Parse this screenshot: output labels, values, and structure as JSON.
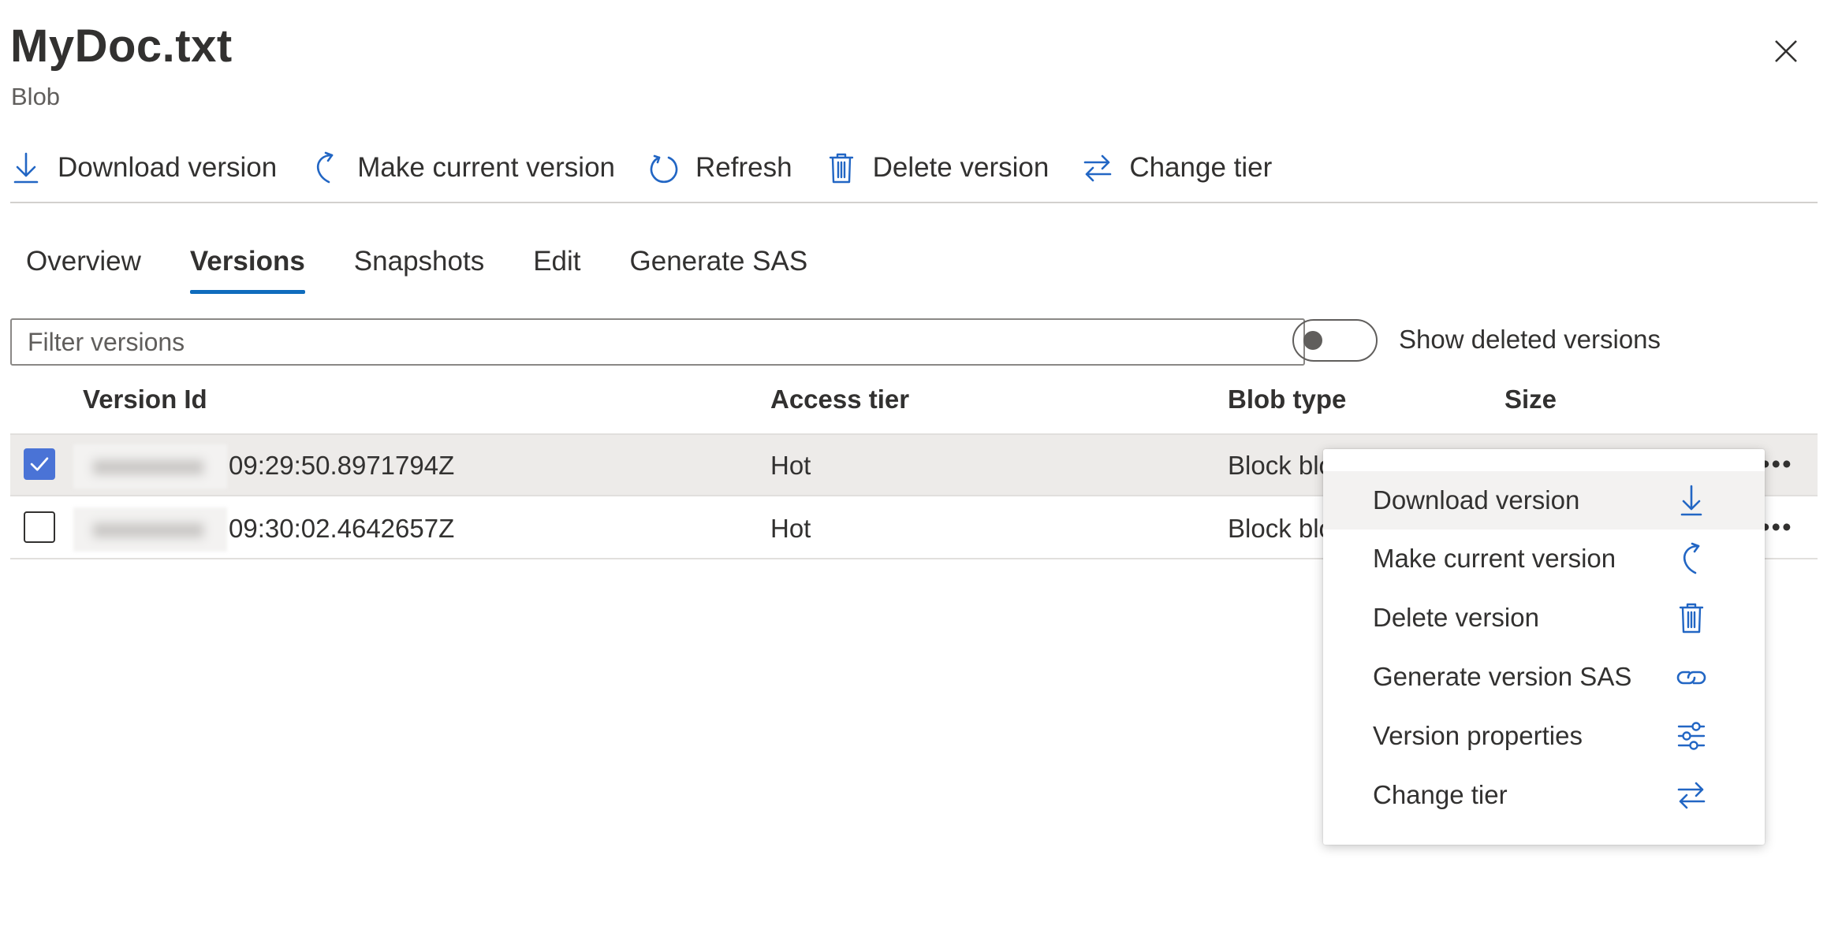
{
  "header": {
    "title": "MyDoc.txt",
    "subtitle": "Blob",
    "close_icon": "close-icon"
  },
  "toolbar": {
    "download": "Download version",
    "make_current": "Make current version",
    "refresh": "Refresh",
    "delete": "Delete version",
    "change_tier": "Change tier"
  },
  "tabs": {
    "overview": "Overview",
    "versions": "Versions",
    "snapshots": "Snapshots",
    "edit": "Edit",
    "generate_sas": "Generate SAS",
    "active": "Versions"
  },
  "filter": {
    "placeholder": "Filter versions"
  },
  "toggle": {
    "label": "Show deleted versions",
    "on": false
  },
  "table": {
    "columns": {
      "version_id": "Version Id",
      "access_tier": "Access tier",
      "blob_type": "Blob type",
      "size": "Size"
    },
    "rows": [
      {
        "version_suffix": "09:29:50.8971794Z",
        "access_tier": "Hot",
        "blob_type": "Block blo",
        "selected": true
      },
      {
        "version_suffix": "09:30:02.4642657Z",
        "access_tier": "Hot",
        "blob_type": "Block blo",
        "selected": false
      }
    ],
    "more_label": "•••"
  },
  "context_menu": {
    "items": [
      {
        "label": "Download version",
        "icon": "download-icon"
      },
      {
        "label": "Make current version",
        "icon": "make-current-icon"
      },
      {
        "label": "Delete version",
        "icon": "trash-icon"
      },
      {
        "label": "Generate version SAS",
        "icon": "link-icon"
      },
      {
        "label": "Version properties",
        "icon": "sliders-icon"
      },
      {
        "label": "Change tier",
        "icon": "swap-arrows-icon"
      }
    ]
  },
  "colors": {
    "accent": "#0f6cbd",
    "icon_blue": "#2266c4",
    "checkbox_blue": "#4a73d6",
    "selected_row": "#edebe9",
    "text": "#323130"
  }
}
